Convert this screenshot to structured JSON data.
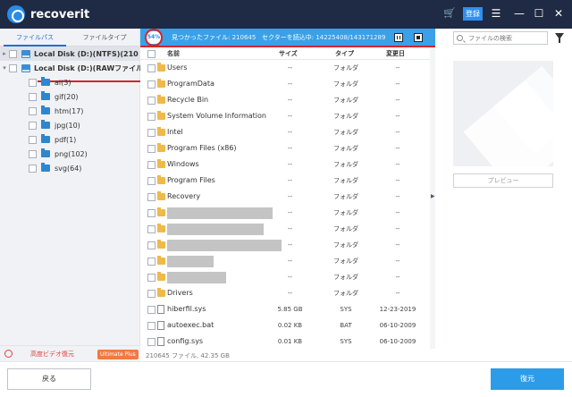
{
  "app": {
    "logo_text": "recoverit",
    "register_label": "登録",
    "colors": {
      "titlebar": "#1f2a44",
      "accent": "#3aa0e8",
      "highlight": "#d4252c"
    }
  },
  "left_panel": {
    "tabs": [
      "ファイルパス",
      "ファイルタイプ"
    ],
    "drives": [
      {
        "label": "Local Disk (D:)(NTFS)(210",
        "icon": "drive-icon"
      },
      {
        "label": "Local Disk (D:)(RAWファイル",
        "icon": "drive-icon"
      }
    ],
    "folders": [
      "ai(3)",
      "gif(20)",
      "htm(17)",
      "jpg(10)",
      "pdf(1)",
      "png(102)",
      "svg(64)"
    ]
  },
  "status": {
    "percent": "54%",
    "found_label": "見つかったファイル:",
    "found_count": "210645",
    "sector_label": "セクターを読込中:",
    "sector_progress": "14225408/143171289"
  },
  "search": {
    "placeholder": "ファイルの検索"
  },
  "table": {
    "headers": {
      "name": "名前",
      "size": "サイズ",
      "type": "タイプ",
      "date": "変更日"
    },
    "rows": [
      {
        "name": "Users",
        "size": "--",
        "type": "フォルダ",
        "date": "--",
        "icon": "folder"
      },
      {
        "name": "ProgramData",
        "size": "--",
        "type": "フォルダ",
        "date": "--",
        "icon": "folder"
      },
      {
        "name": "Recycle Bin",
        "size": "--",
        "type": "フォルダ",
        "date": "--",
        "icon": "folder"
      },
      {
        "name": "System Volume Information",
        "size": "--",
        "type": "フォルダ",
        "date": "--",
        "icon": "folder"
      },
      {
        "name": "Intel",
        "size": "--",
        "type": "フォルダ",
        "date": "--",
        "icon": "folder"
      },
      {
        "name": "Program Files (x86)",
        "size": "--",
        "type": "フォルダ",
        "date": "--",
        "icon": "folder"
      },
      {
        "name": "Windows",
        "size": "--",
        "type": "フォルダ",
        "date": "--",
        "icon": "folder"
      },
      {
        "name": "Program Files",
        "size": "--",
        "type": "フォルダ",
        "date": "--",
        "icon": "folder"
      },
      {
        "name": "Recovery",
        "size": "--",
        "type": "フォルダ",
        "date": "--",
        "icon": "folder"
      },
      {
        "name": "",
        "size": "--",
        "type": "フォルダ",
        "date": "--",
        "icon": "folder",
        "redacted": true
      },
      {
        "name": "",
        "size": "--",
        "type": "フォルダ",
        "date": "--",
        "icon": "folder",
        "redacted": true
      },
      {
        "name": "",
        "size": "--",
        "type": "フォルダ",
        "date": "--",
        "icon": "folder",
        "redacted": true
      },
      {
        "name": "",
        "size": "--",
        "type": "フォルダ",
        "date": "--",
        "icon": "folder",
        "redacted": true
      },
      {
        "name": "",
        "size": "--",
        "type": "フォルダ",
        "date": "--",
        "icon": "folder",
        "redacted": true
      },
      {
        "name": "Drivers",
        "size": "--",
        "type": "フォルダ",
        "date": "--",
        "icon": "folder"
      },
      {
        "name": "hiberfil.sys",
        "size": "5.85  GB",
        "type": "SYS",
        "date": "12-23-2019",
        "icon": "file"
      },
      {
        "name": "autoexec.bat",
        "size": "0.02  KB",
        "type": "BAT",
        "date": "06-10-2009",
        "icon": "file"
      },
      {
        "name": "config.sys",
        "size": "0.01  KB",
        "type": "SYS",
        "date": "06-10-2009",
        "icon": "file"
      }
    ],
    "summary": "210645 ファイル, 42.35  GB"
  },
  "preview": {
    "button_label": "プレビュー"
  },
  "bottom": {
    "advanced_video_label": "高度ビデオ復元",
    "ultimate_badge": "Ultimate Plus",
    "back_label": "戻る",
    "recover_label": "復元"
  }
}
